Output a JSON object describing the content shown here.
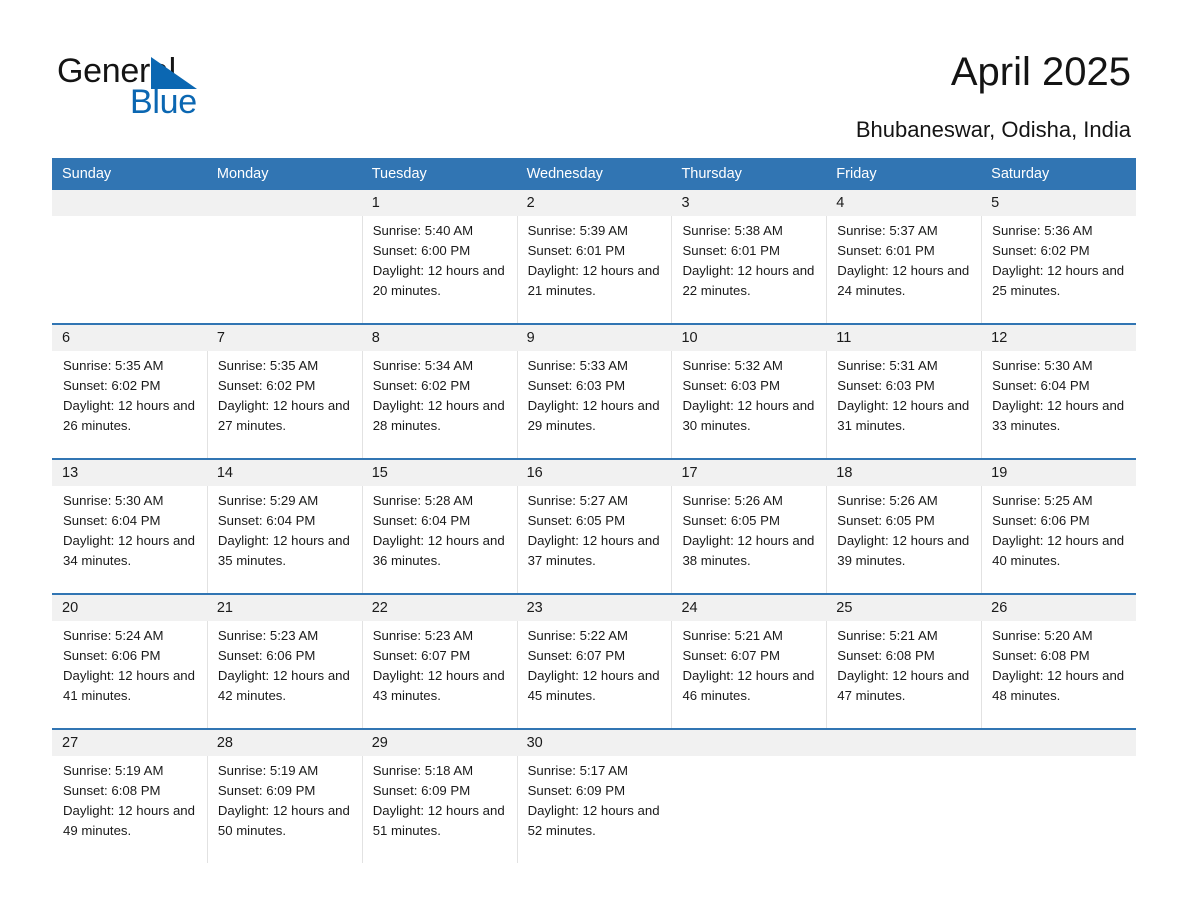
{
  "brand": {
    "name_part1": "General",
    "name_part2": "Blue",
    "triangle_color": "#0b67b2"
  },
  "header": {
    "month_title": "April 2025",
    "location": "Bhubaneswar, Odisha, India",
    "accent_color": "#3175b3"
  },
  "weekdays": [
    "Sunday",
    "Monday",
    "Tuesday",
    "Wednesday",
    "Thursday",
    "Friday",
    "Saturday"
  ],
  "weeks": [
    [
      {
        "empty": true
      },
      {
        "empty": true
      },
      {
        "date": "1",
        "sunrise": "Sunrise: 5:40 AM",
        "sunset": "Sunset: 6:00 PM",
        "daylight": "Daylight: 12 hours and 20 minutes."
      },
      {
        "date": "2",
        "sunrise": "Sunrise: 5:39 AM",
        "sunset": "Sunset: 6:01 PM",
        "daylight": "Daylight: 12 hours and 21 minutes."
      },
      {
        "date": "3",
        "sunrise": "Sunrise: 5:38 AM",
        "sunset": "Sunset: 6:01 PM",
        "daylight": "Daylight: 12 hours and 22 minutes."
      },
      {
        "date": "4",
        "sunrise": "Sunrise: 5:37 AM",
        "sunset": "Sunset: 6:01 PM",
        "daylight": "Daylight: 12 hours and 24 minutes."
      },
      {
        "date": "5",
        "sunrise": "Sunrise: 5:36 AM",
        "sunset": "Sunset: 6:02 PM",
        "daylight": "Daylight: 12 hours and 25 minutes."
      }
    ],
    [
      {
        "date": "6",
        "sunrise": "Sunrise: 5:35 AM",
        "sunset": "Sunset: 6:02 PM",
        "daylight": "Daylight: 12 hours and 26 minutes."
      },
      {
        "date": "7",
        "sunrise": "Sunrise: 5:35 AM",
        "sunset": "Sunset: 6:02 PM",
        "daylight": "Daylight: 12 hours and 27 minutes."
      },
      {
        "date": "8",
        "sunrise": "Sunrise: 5:34 AM",
        "sunset": "Sunset: 6:02 PM",
        "daylight": "Daylight: 12 hours and 28 minutes."
      },
      {
        "date": "9",
        "sunrise": "Sunrise: 5:33 AM",
        "sunset": "Sunset: 6:03 PM",
        "daylight": "Daylight: 12 hours and 29 minutes."
      },
      {
        "date": "10",
        "sunrise": "Sunrise: 5:32 AM",
        "sunset": "Sunset: 6:03 PM",
        "daylight": "Daylight: 12 hours and 30 minutes."
      },
      {
        "date": "11",
        "sunrise": "Sunrise: 5:31 AM",
        "sunset": "Sunset: 6:03 PM",
        "daylight": "Daylight: 12 hours and 31 minutes."
      },
      {
        "date": "12",
        "sunrise": "Sunrise: 5:30 AM",
        "sunset": "Sunset: 6:04 PM",
        "daylight": "Daylight: 12 hours and 33 minutes."
      }
    ],
    [
      {
        "date": "13",
        "sunrise": "Sunrise: 5:30 AM",
        "sunset": "Sunset: 6:04 PM",
        "daylight": "Daylight: 12 hours and 34 minutes."
      },
      {
        "date": "14",
        "sunrise": "Sunrise: 5:29 AM",
        "sunset": "Sunset: 6:04 PM",
        "daylight": "Daylight: 12 hours and 35 minutes."
      },
      {
        "date": "15",
        "sunrise": "Sunrise: 5:28 AM",
        "sunset": "Sunset: 6:04 PM",
        "daylight": "Daylight: 12 hours and 36 minutes."
      },
      {
        "date": "16",
        "sunrise": "Sunrise: 5:27 AM",
        "sunset": "Sunset: 6:05 PM",
        "daylight": "Daylight: 12 hours and 37 minutes."
      },
      {
        "date": "17",
        "sunrise": "Sunrise: 5:26 AM",
        "sunset": "Sunset: 6:05 PM",
        "daylight": "Daylight: 12 hours and 38 minutes."
      },
      {
        "date": "18",
        "sunrise": "Sunrise: 5:26 AM",
        "sunset": "Sunset: 6:05 PM",
        "daylight": "Daylight: 12 hours and 39 minutes."
      },
      {
        "date": "19",
        "sunrise": "Sunrise: 5:25 AM",
        "sunset": "Sunset: 6:06 PM",
        "daylight": "Daylight: 12 hours and 40 minutes."
      }
    ],
    [
      {
        "date": "20",
        "sunrise": "Sunrise: 5:24 AM",
        "sunset": "Sunset: 6:06 PM",
        "daylight": "Daylight: 12 hours and 41 minutes."
      },
      {
        "date": "21",
        "sunrise": "Sunrise: 5:23 AM",
        "sunset": "Sunset: 6:06 PM",
        "daylight": "Daylight: 12 hours and 42 minutes."
      },
      {
        "date": "22",
        "sunrise": "Sunrise: 5:23 AM",
        "sunset": "Sunset: 6:07 PM",
        "daylight": "Daylight: 12 hours and 43 minutes."
      },
      {
        "date": "23",
        "sunrise": "Sunrise: 5:22 AM",
        "sunset": "Sunset: 6:07 PM",
        "daylight": "Daylight: 12 hours and 45 minutes."
      },
      {
        "date": "24",
        "sunrise": "Sunrise: 5:21 AM",
        "sunset": "Sunset: 6:07 PM",
        "daylight": "Daylight: 12 hours and 46 minutes."
      },
      {
        "date": "25",
        "sunrise": "Sunrise: 5:21 AM",
        "sunset": "Sunset: 6:08 PM",
        "daylight": "Daylight: 12 hours and 47 minutes."
      },
      {
        "date": "26",
        "sunrise": "Sunrise: 5:20 AM",
        "sunset": "Sunset: 6:08 PM",
        "daylight": "Daylight: 12 hours and 48 minutes."
      }
    ],
    [
      {
        "date": "27",
        "sunrise": "Sunrise: 5:19 AM",
        "sunset": "Sunset: 6:08 PM",
        "daylight": "Daylight: 12 hours and 49 minutes."
      },
      {
        "date": "28",
        "sunrise": "Sunrise: 5:19 AM",
        "sunset": "Sunset: 6:09 PM",
        "daylight": "Daylight: 12 hours and 50 minutes."
      },
      {
        "date": "29",
        "sunrise": "Sunrise: 5:18 AM",
        "sunset": "Sunset: 6:09 PM",
        "daylight": "Daylight: 12 hours and 51 minutes."
      },
      {
        "date": "30",
        "sunrise": "Sunrise: 5:17 AM",
        "sunset": "Sunset: 6:09 PM",
        "daylight": "Daylight: 12 hours and 52 minutes."
      },
      {
        "empty": true
      },
      {
        "empty": true
      },
      {
        "empty": true
      }
    ]
  ]
}
